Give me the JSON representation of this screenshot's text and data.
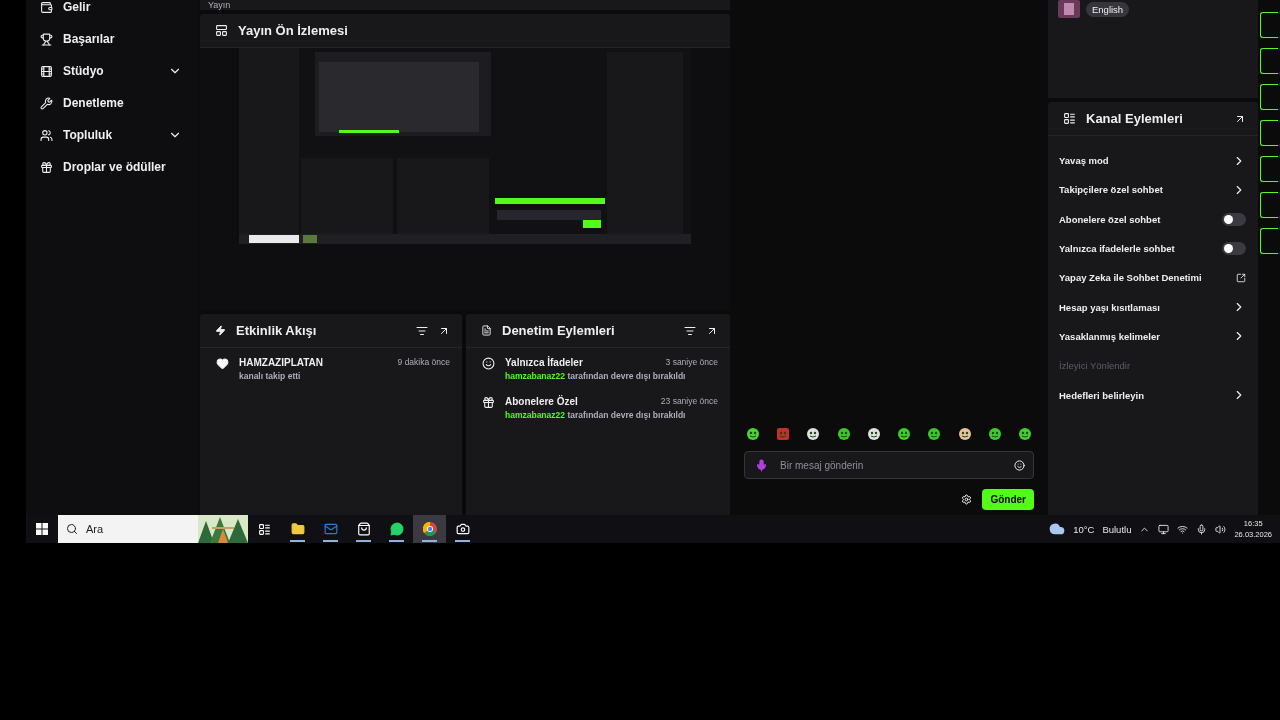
{
  "top_strip": {
    "column_1": "Yayın"
  },
  "sidebar": {
    "items": [
      {
        "label": "Gelir",
        "has_submenu": false
      },
      {
        "label": "Başarılar",
        "has_submenu": false
      },
      {
        "label": "Stüdyo",
        "has_submenu": true
      },
      {
        "label": "Denetleme",
        "has_submenu": false
      },
      {
        "label": "Topluluk",
        "has_submenu": true
      },
      {
        "label": "Droplar ve ödüller",
        "has_submenu": false
      }
    ]
  },
  "preview": {
    "title": "Yayın Ön İzlemesi",
    "kind": "picture"
  },
  "activity": {
    "title": "Etkinlik Akışı",
    "events": [
      {
        "user": "HAMZAZIPLATAN",
        "action": "kanalı takip etti",
        "time": "9 dakika önce"
      }
    ]
  },
  "moderation": {
    "title": "Denetim Eylemleri",
    "actions": [
      {
        "kind": "emote",
        "title": "Yalnızca İfadeler",
        "user": "hamzabanaz22",
        "text": "tarafından devre dışı bırakıldı",
        "time": "3 saniye önce"
      },
      {
        "kind": "gift",
        "title": "Abonelere Özel",
        "user": "hamzabanaz22",
        "text": "tarafından devre dışı bırakıldı",
        "time": "23 saniye önce"
      }
    ]
  },
  "chat": {
    "placeholder": "Bir mesaj gönderin",
    "send": "Gönder"
  },
  "stream_info": {
    "language": "English"
  },
  "channel_actions": {
    "title": "Kanal Eylemleri",
    "items": [
      {
        "kind": "link",
        "label": "Yavaş mod"
      },
      {
        "kind": "link",
        "label": "Takipçilere özel sohbet"
      },
      {
        "kind": "toggle",
        "label": "Abonelere özel sohbet",
        "on": false
      },
      {
        "kind": "toggle",
        "label": "Yalnızca ifadelerle sohbet",
        "on": false
      },
      {
        "kind": "external",
        "label": "Yapay Zeka ile Sohbet Denetimi"
      },
      {
        "kind": "link",
        "label": "Hesap yaşı kısıtlaması"
      },
      {
        "kind": "link",
        "label": "Yasaklanmış kelimeler"
      },
      {
        "kind": "section",
        "label": "İzleyici Yönlendir"
      },
      {
        "kind": "link",
        "label": "Hedefleri belirleyin"
      }
    ]
  },
  "taskbar": {
    "search_placeholder": "Ara",
    "apps": [
      {
        "selected": false
      },
      {
        "selected": false
      },
      {
        "selected": false
      },
      {
        "selected": false
      },
      {
        "selected": true
      },
      {
        "selected": false
      }
    ],
    "weather": {
      "temperature": "10°C",
      "condition": "Bulutlu"
    },
    "time": "16:35",
    "date": "26.03.2026"
  }
}
